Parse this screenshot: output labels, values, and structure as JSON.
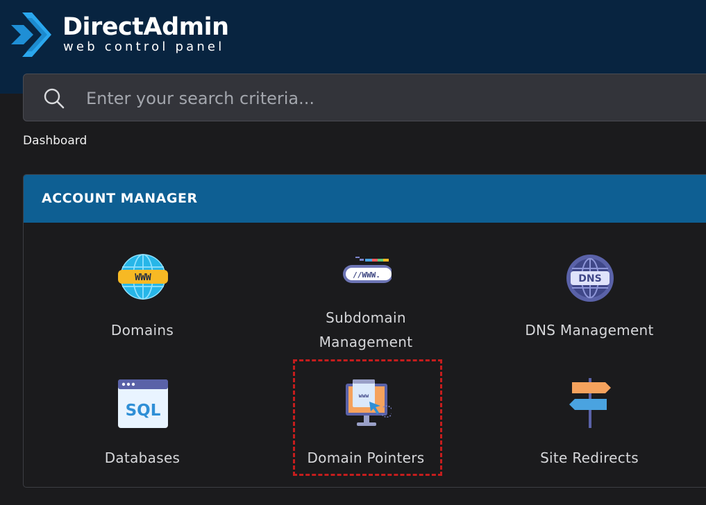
{
  "brand": {
    "title": "DirectAdmin",
    "subtitle": "web control panel"
  },
  "search": {
    "placeholder": "Enter your search criteria..."
  },
  "breadcrumb": "Dashboard",
  "panel": {
    "title": "ACCOUNT MANAGER",
    "items": [
      {
        "label": "Domains",
        "icon": "globe-www-icon"
      },
      {
        "label": "Subdomain Management",
        "label_line1": "Subdomain",
        "label_line2": "Management",
        "icon": "browser-address-bar-icon"
      },
      {
        "label": "DNS Management",
        "icon": "dns-globe-icon"
      },
      {
        "label": "Databases",
        "icon": "sql-window-icon"
      },
      {
        "label": "Domain Pointers",
        "icon": "monitor-www-pointer-icon"
      },
      {
        "label": "Site Redirects",
        "icon": "signpost-arrows-icon"
      }
    ]
  },
  "colors": {
    "header_bg": "#082440",
    "panel_head": "#0e5f93",
    "highlight": "#c41d1d",
    "page_bg": "#1b1b1d"
  }
}
